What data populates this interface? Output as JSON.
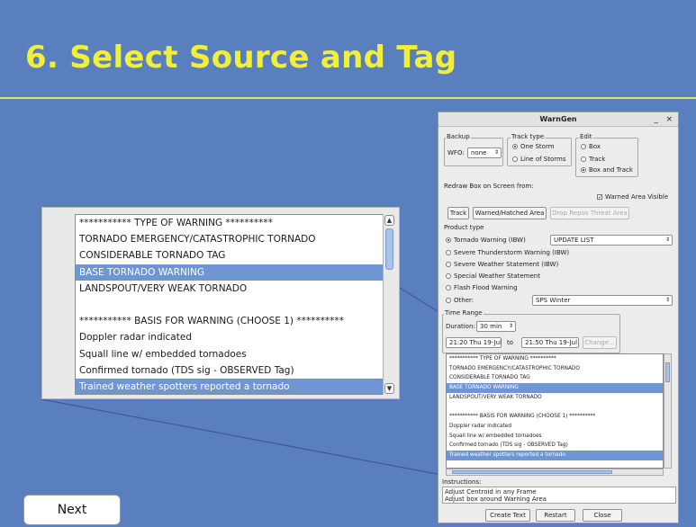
{
  "slide": {
    "title": "6. Select Source and Tag",
    "next_label": "Next"
  },
  "zoom_list": {
    "items": [
      "*********** TYPE OF WARNING **********",
      "TORNADO EMERGENCY/CATASTROPHIC TORNADO",
      "CONSIDERABLE TORNADO TAG",
      "BASE TORNADO WARNING",
      "LANDSPOUT/VERY WEAK TORNADO",
      "",
      "*********** BASIS FOR WARNING (CHOOSE 1) **********",
      "Doppler radar indicated",
      "Squall line w/ embedded tornadoes",
      "Confirmed tornado (TDS sig - OBSERVED Tag)",
      "Trained weather spotters reported a tornado"
    ],
    "selected": [
      3,
      10
    ]
  },
  "dialog": {
    "title": "WarnGen",
    "minimize": "_",
    "close": "×",
    "backup": {
      "label": "Backup",
      "wfo_label": "WFO:",
      "wfo_value": "none"
    },
    "track_type": {
      "label": "Track type",
      "options": [
        "One Storm",
        "Line of Storms"
      ],
      "selected": 0
    },
    "edit": {
      "label": "Edit",
      "options": [
        "Box",
        "Track",
        "Box and Track"
      ],
      "selected": 2
    },
    "redraw": {
      "label": "Redraw Box on Screen from:",
      "warned_area_visible": "Warned Area Visible",
      "buttons": [
        "Track",
        "Warned/Hatched Area",
        "Drop Repos Threat Area"
      ]
    },
    "product_type": {
      "label": "Product type",
      "options": [
        "Tornado Warning (IBW)",
        "Severe Thunderstorm Warning (IBW)",
        "Severe Weather Statement (IBW)",
        "Special Weather Statement",
        "Flash Flood Warning",
        "Other:"
      ],
      "selected": 0,
      "update_list": "UPDATE LIST",
      "other_value": "SPS Winter"
    },
    "time_range": {
      "label": "Time Range",
      "duration_label": "Duration:",
      "duration_value": "30 min",
      "start": "21:20 Thu 19-Jul",
      "to": "to",
      "end": "21:50 Thu 19-Jul",
      "change_label": "Change..."
    },
    "list": {
      "items": [
        "*********** TYPE OF WARNING **********",
        "TORNADO EMERGENCY/CATASTROPHIC TORNADO",
        "CONSIDERABLE TORNADO TAG",
        "BASE TORNADO WARNING",
        "LANDSPOUT/VERY WEAK TORNADO",
        "",
        "*********** BASIS FOR WARNING (CHOOSE 1) **********",
        "Doppler radar indicated",
        "Squall line w/ embedded tornadoes",
        "Confirmed tornado (TDS sig - OBSERVED Tag)",
        "Trained weather spotters reported a tornado"
      ],
      "selected": [
        3,
        10
      ]
    },
    "instructions": {
      "label": "Instructions:",
      "lines": [
        "Adjust Centroid in any Frame",
        "Adjust box around Warning Area"
      ]
    },
    "buttons": {
      "create": "Create Text",
      "restart": "Restart",
      "close": "Close"
    }
  }
}
